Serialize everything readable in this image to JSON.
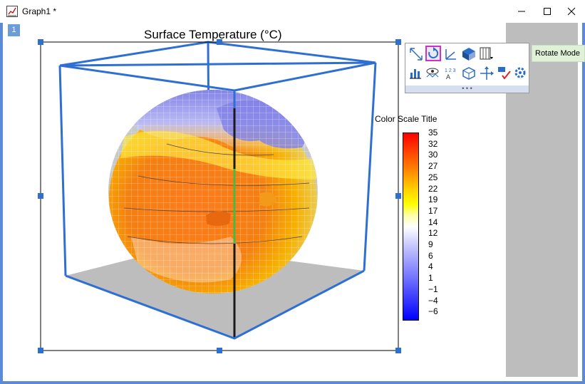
{
  "window": {
    "title": "Graph1 *"
  },
  "page_tab": "1",
  "plot": {
    "title": "Surface Temperature (°C)"
  },
  "tooltip": "Rotate Mode",
  "colorscale": {
    "title": "Color Scale Title",
    "labels": [
      "35",
      "32",
      "30",
      "27",
      "25",
      "22",
      "19",
      "17",
      "14",
      "12",
      "9",
      "6",
      "4",
      "1",
      "−1",
      "−4",
      "−6"
    ]
  },
  "toolbar": {
    "buttons": [
      "scale-icon",
      "rotate-icon",
      "axes-icon",
      "cube-light-icon",
      "grid-icon",
      "bar-chart-icon",
      "eye-icon",
      "label-axis-icon",
      "cube-icon",
      "move-axes-icon",
      "text-check-icon",
      "gear-icon"
    ]
  }
}
